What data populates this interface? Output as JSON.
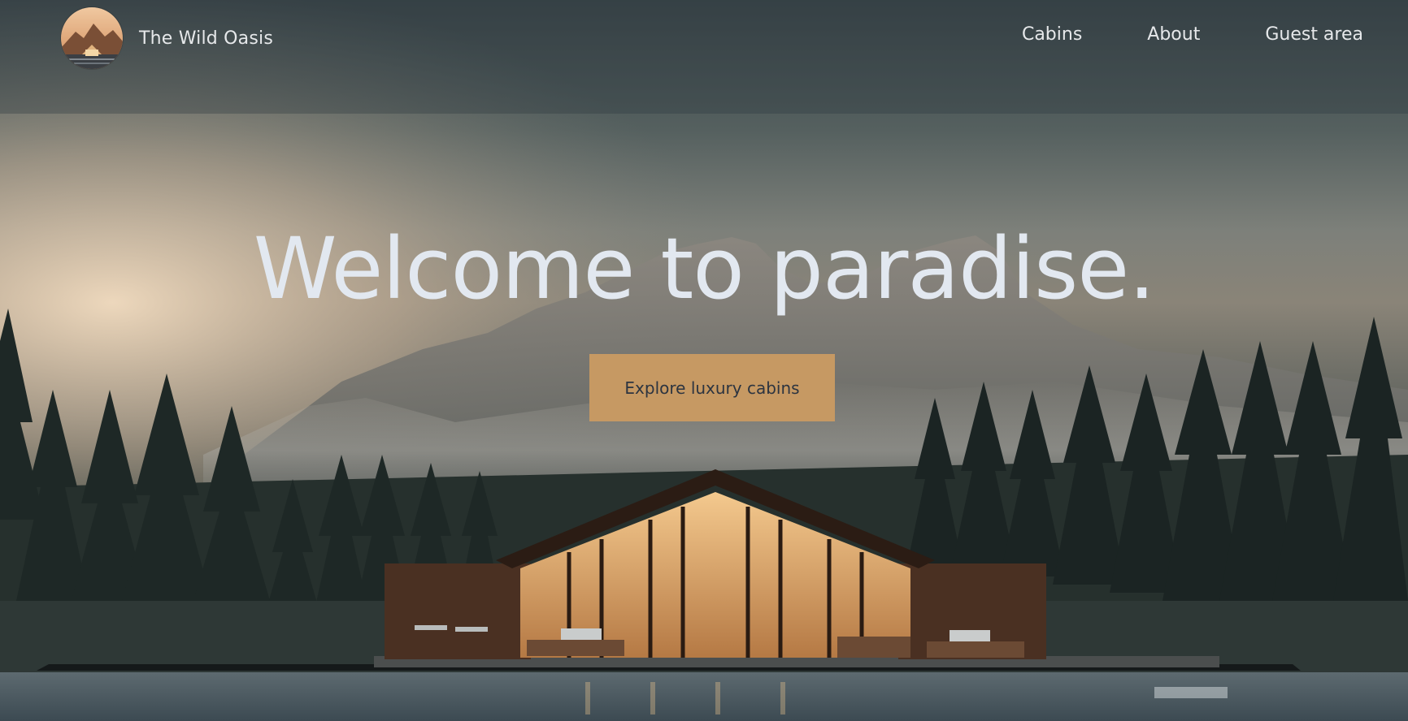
{
  "header": {
    "brand_name": "The Wild Oasis",
    "logo_icon": "cabin-mountain-logo-icon",
    "nav": {
      "cabins": "Cabins",
      "about": "About",
      "guest_area": "Guest area"
    }
  },
  "hero": {
    "title": "Welcome to paradise.",
    "cta_label": "Explore luxury cabins"
  },
  "colors": {
    "accent": "#c69963",
    "text_light": "#e2e8f0",
    "cta_text": "#2c3440"
  }
}
